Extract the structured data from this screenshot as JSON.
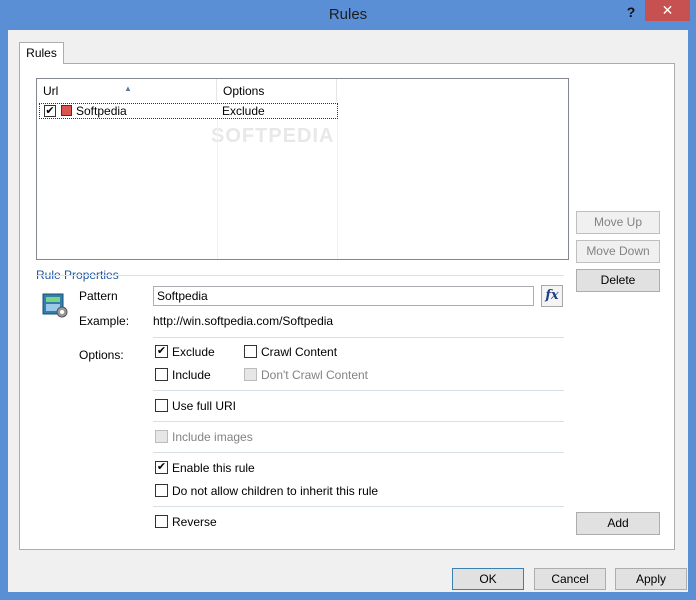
{
  "window": {
    "title": "Rules",
    "help": "?",
    "close": "✕"
  },
  "tabs": [
    {
      "label": "Rules"
    }
  ],
  "list": {
    "columns": [
      "Url",
      "Options"
    ],
    "rows": [
      {
        "checked": true,
        "url": "Softpedia",
        "options": "Exclude"
      }
    ],
    "watermark": "SOFTPEDIA"
  },
  "side_buttons": {
    "move_up": "Move  Up",
    "move_down": "Move Down",
    "delete": "Delete",
    "add": "Add"
  },
  "rule_properties": {
    "group_label": "Rule Properties",
    "pattern_label": "Pattern",
    "pattern_value": "Softpedia",
    "fx_label": "fx",
    "example_label": "Example:",
    "example_value": "http://win.softpedia.com/Softpedia",
    "options_label": "Options:",
    "checkboxes": {
      "exclude": {
        "label": "Exclude",
        "checked": true
      },
      "crawl_content": {
        "label": "Crawl Content",
        "checked": false
      },
      "include": {
        "label": "Include",
        "checked": false
      },
      "dont_crawl_content": {
        "label": "Don't Crawl Content",
        "checked": false,
        "disabled": true
      },
      "use_full_uri": {
        "label": "Use full URI",
        "checked": false
      },
      "include_images": {
        "label": "Include images",
        "checked": false,
        "disabled": true
      },
      "enable_rule": {
        "label": "Enable this rule",
        "checked": true
      },
      "no_inherit": {
        "label": "Do not allow children to inherit this rule",
        "checked": false
      },
      "reverse": {
        "label": "Reverse",
        "checked": false
      }
    }
  },
  "footer": {
    "ok": "OK",
    "cancel": "Cancel",
    "apply": "Apply"
  },
  "colors": {
    "accent": "#1c56a0",
    "titlebar": "#5a8fd6",
    "close": "#c75050"
  }
}
